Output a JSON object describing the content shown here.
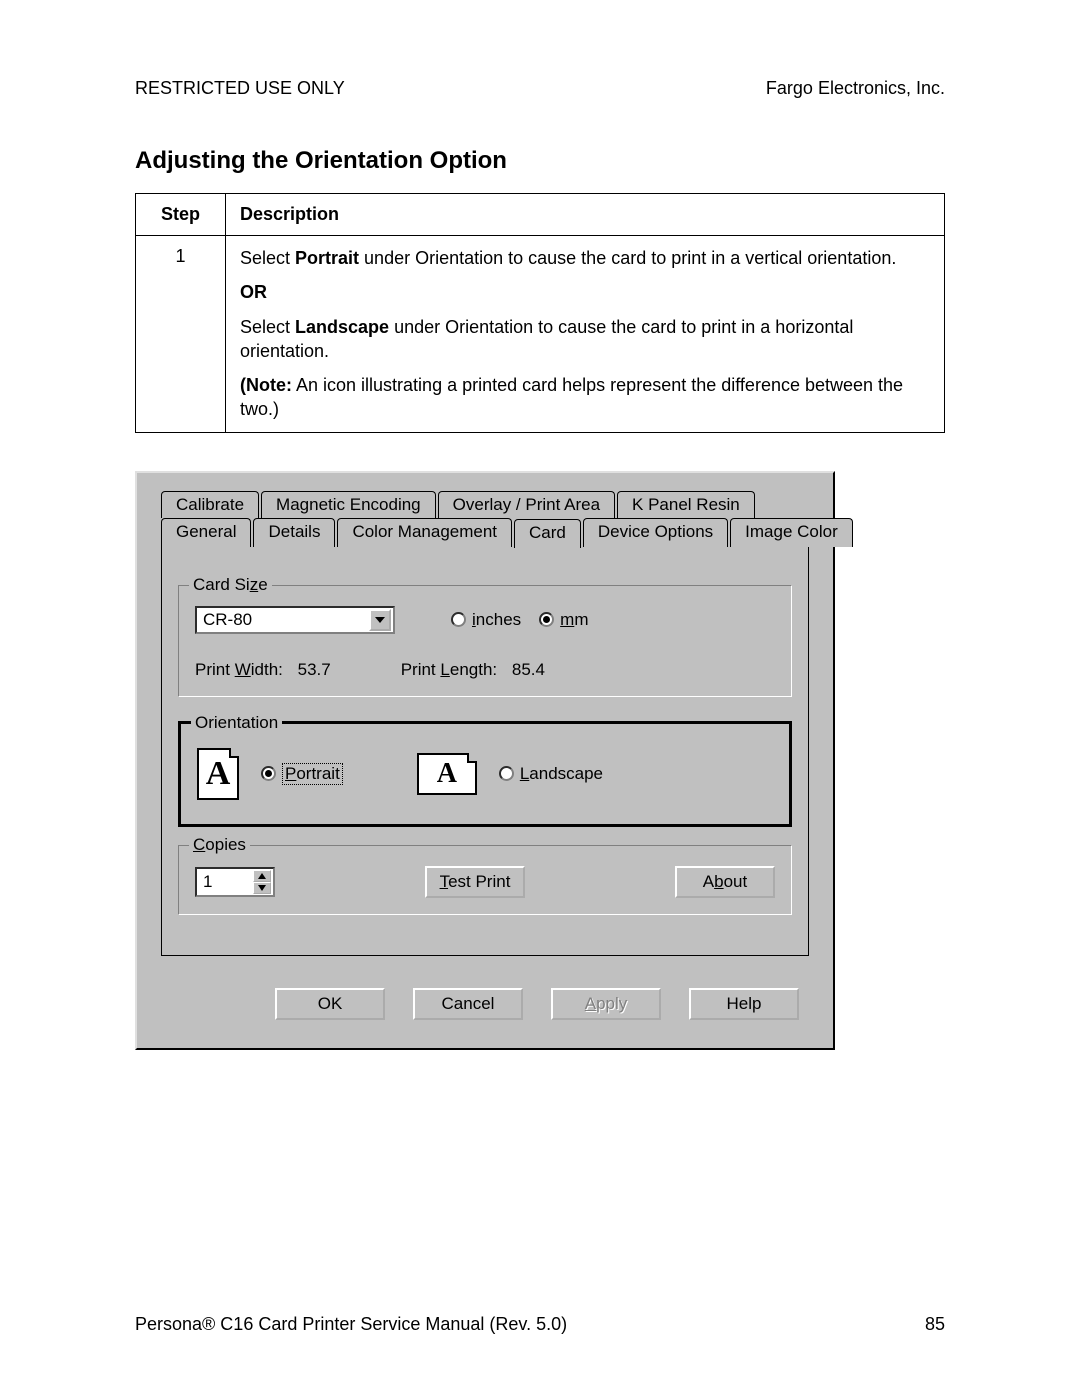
{
  "header": {
    "left": "RESTRICTED USE ONLY",
    "right": "Fargo Electronics, Inc."
  },
  "section_title": "Adjusting the Orientation Option",
  "table": {
    "head_step": "Step",
    "head_desc": "Description",
    "row": {
      "step": "1",
      "p1a": "Select ",
      "p1b": "Portrait",
      "p1c": " under Orientation to cause the card to print in a vertical orientation.",
      "or": "OR",
      "p2a": "Select ",
      "p2b": "Landscape",
      "p2c": " under Orientation to cause the card to print in a horizontal orientation.",
      "p3a": "(Note:",
      "p3b": "  An icon illustrating a printed card helps represent the difference between the two.)"
    }
  },
  "dialog": {
    "tabs_top": [
      "Calibrate",
      "Magnetic Encoding",
      "Overlay / Print Area",
      "K Panel Resin"
    ],
    "tabs_bottom": [
      "General",
      "Details",
      "Color Management",
      "Card",
      "Device Options",
      "Image Color"
    ],
    "card_size": {
      "legend_pre": "Card Si",
      "legend_ul": "z",
      "legend_post": "e",
      "combo_value": "CR-80",
      "radio_inches_ul": "i",
      "radio_inches_rest": "nches",
      "radio_mm_ul": "m",
      "radio_mm_rest": "m",
      "width_label_pre": "Print ",
      "width_label_ul": "W",
      "width_label_post": "idth:",
      "width_value": "53.7",
      "length_label_pre": "Print ",
      "length_label_ul": "L",
      "length_label_post": "ength:",
      "length_value": "85.4"
    },
    "orientation": {
      "legend": "Orientation",
      "portrait_ul": "P",
      "portrait_rest": "ortrait",
      "landscape_ul": "L",
      "landscape_rest": "andscape",
      "icon_letter": "A"
    },
    "copies": {
      "legend_ul": "C",
      "legend_rest": "opies",
      "value": "1",
      "test_print_ul": "T",
      "test_print_rest": "est Print",
      "about_pre": "A",
      "about_ul": "b",
      "about_post": "out"
    },
    "buttons": {
      "ok": "OK",
      "cancel": "Cancel",
      "apply_ul": "A",
      "apply_rest": "pply",
      "help": "Help"
    }
  },
  "footer": {
    "left": "Persona® C16 Card Printer Service Manual (Rev. 5.0)",
    "right": "85"
  }
}
